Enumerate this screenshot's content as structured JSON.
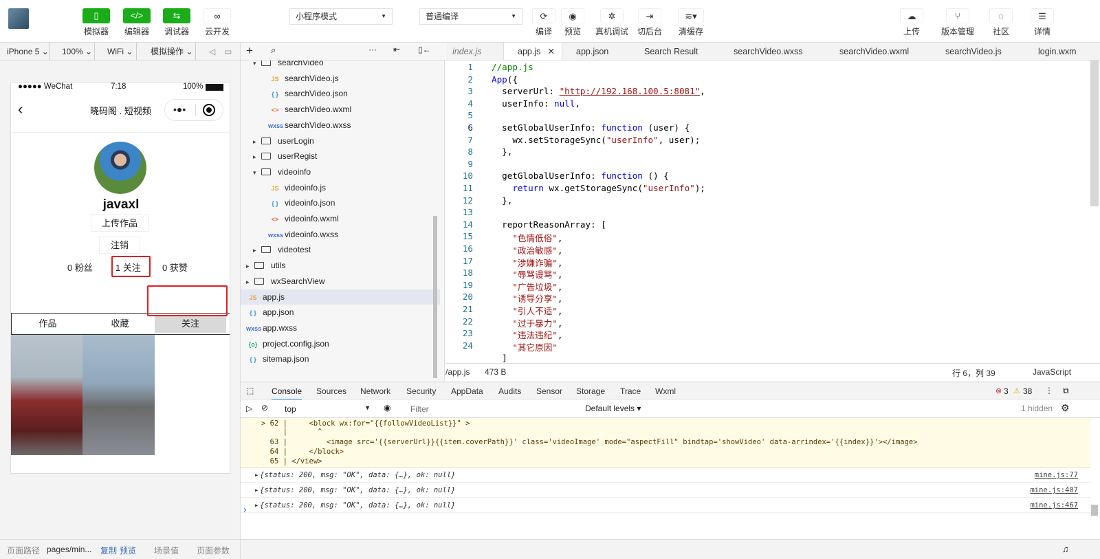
{
  "toolbar": {
    "simulator": "模拟器",
    "editor": "编辑器",
    "debugger": "调试器",
    "cloud": "云开发",
    "mode": "小程序模式",
    "compile_mode": "普通编译",
    "compile": "编译",
    "preview": "预览",
    "real_debug": "真机调试",
    "background": "切后台",
    "clear_cache": "清缓存",
    "upload": "上传",
    "version": "版本管理",
    "community": "社区",
    "details": "详情"
  },
  "device_bar": {
    "device": "iPhone 5",
    "zoom": "100%",
    "network": "WiFi",
    "sim_ops": "模拟操作"
  },
  "phone": {
    "carrier": "●●●●● WeChat",
    "time": "7:18",
    "battery": "100%",
    "nav_title": "晓码阁 . 短视频",
    "username": "javaxl",
    "upload_btn": "上传作品",
    "logout_btn": "注销",
    "fans": "0 粉丝",
    "follows": "1 关注",
    "likes": "0 获赞",
    "tabs": [
      "作品",
      "收藏",
      "关注"
    ]
  },
  "sim_status": {
    "path_label": "页面路径",
    "path": "pages/min...",
    "copy": "复制",
    "preview": "预览",
    "scene": "场景值",
    "params": "页面参数"
  },
  "tree": [
    {
      "name": "searchVideo",
      "type": "folder-open",
      "indent": 1
    },
    {
      "name": "searchVideo.js",
      "type": "js",
      "indent": 2
    },
    {
      "name": "searchVideo.json",
      "type": "json",
      "indent": 2
    },
    {
      "name": "searchVideo.wxml",
      "type": "wxml",
      "indent": 2
    },
    {
      "name": "searchVideo.wxss",
      "type": "wxss",
      "indent": 2
    },
    {
      "name": "userLogin",
      "type": "folder",
      "indent": 1
    },
    {
      "name": "userRegist",
      "type": "folder",
      "indent": 1
    },
    {
      "name": "videoinfo",
      "type": "folder-open",
      "indent": 1
    },
    {
      "name": "videoinfo.js",
      "type": "js",
      "indent": 2
    },
    {
      "name": "videoinfo.json",
      "type": "json",
      "indent": 2
    },
    {
      "name": "videoinfo.wxml",
      "type": "wxml",
      "indent": 2
    },
    {
      "name": "videoinfo.wxss",
      "type": "wxss",
      "indent": 2
    },
    {
      "name": "videotest",
      "type": "folder",
      "indent": 1
    },
    {
      "name": "utils",
      "type": "folder",
      "indent": 0
    },
    {
      "name": "wxSearchView",
      "type": "folder",
      "indent": 0
    },
    {
      "name": "app.js",
      "type": "js",
      "indent": 0,
      "selected": true
    },
    {
      "name": "app.json",
      "type": "json",
      "indent": 0
    },
    {
      "name": "app.wxss",
      "type": "wxss",
      "indent": 0
    },
    {
      "name": "project.config.json",
      "type": "config",
      "indent": 0
    },
    {
      "name": "sitemap.json",
      "type": "json",
      "indent": 0
    }
  ],
  "editor_tabs": [
    "index.js",
    "app.js",
    "app.json",
    "Search Result",
    "searchVideo.wxss",
    "searchVideo.wxml",
    "searchVideo.js",
    "login.wxm"
  ],
  "editor_status": {
    "path": "/app.js",
    "size": "473 B",
    "pos": "行 6，列 39",
    "lang": "JavaScript"
  },
  "devtools_tabs": [
    "Console",
    "Sources",
    "Network",
    "Security",
    "AppData",
    "Audits",
    "Sensor",
    "Storage",
    "Trace",
    "Wxml"
  ],
  "devtools_counts": {
    "errors": "3",
    "warnings": "38",
    "hidden": "1 hidden"
  },
  "console_filter": {
    "context": "top",
    "placeholder": "Filter",
    "levels": "Default levels"
  },
  "console_logs": [
    {
      "text": "{status: 200, msg: \"OK\", data: {…}, ok: null}",
      "src": "mine.js:77"
    },
    {
      "text": "{status: 200, msg: \"OK\", data: {…}, ok: null}",
      "src": "mine.js:407"
    },
    {
      "text": "{status: 200, msg: \"OK\", data: {…}, ok: null}",
      "src": "mine.js:467"
    }
  ],
  "console_warn": {
    "l62": "> 62 |     <block wx:for=\"{{followVideoList}}\" >",
    "caret": "     |       ^",
    "l63": "  63 |         <image src='{{serverUrl}}{{item.coverPath}}' class='videoImage' mode=\"aspectFill\" bindtap='showVideo' data-arrindex='{{index}}'></image>",
    "l64": "  64 |     </block>",
    "l65": "  65 | </view>"
  },
  "prompt": "›"
}
